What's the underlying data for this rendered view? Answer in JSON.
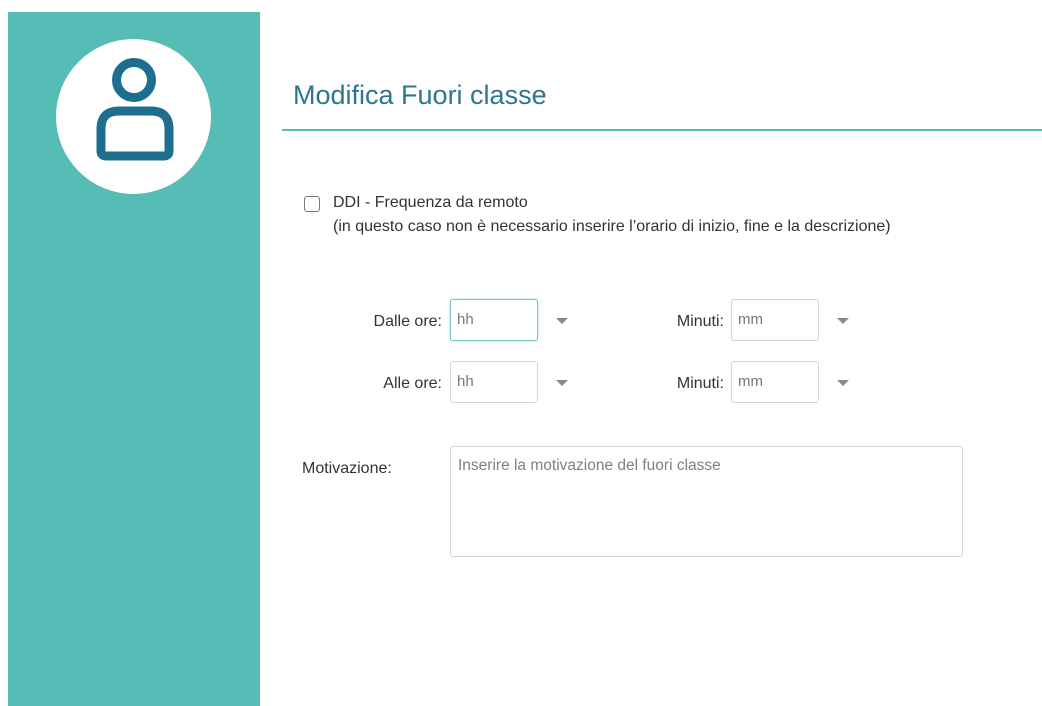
{
  "sidebar": {
    "avatar_icon": "user-icon",
    "background_color": "#55bdb5",
    "icon_color": "#1e6f8f"
  },
  "header": {
    "title": "Modifica Fuori classe",
    "title_color": "#2b7690"
  },
  "ddi": {
    "checked": false,
    "label": "DDI - Frequenza da remoto",
    "note": "(in questo caso non è necessario inserire l’orario di inizio, fine e la descrizione)"
  },
  "time": {
    "from": {
      "label": "Dalle ore:",
      "hours_placeholder": "hh",
      "minutes_label": "Minuti:",
      "minutes_placeholder": "mm"
    },
    "to": {
      "label": "Alle ore:",
      "hours_placeholder": "hh",
      "minutes_label": "Minuti:",
      "minutes_placeholder": "mm"
    }
  },
  "motivation": {
    "label": "Motivazione:",
    "placeholder": "Inserire la motivazione del fuori classe",
    "value": ""
  }
}
